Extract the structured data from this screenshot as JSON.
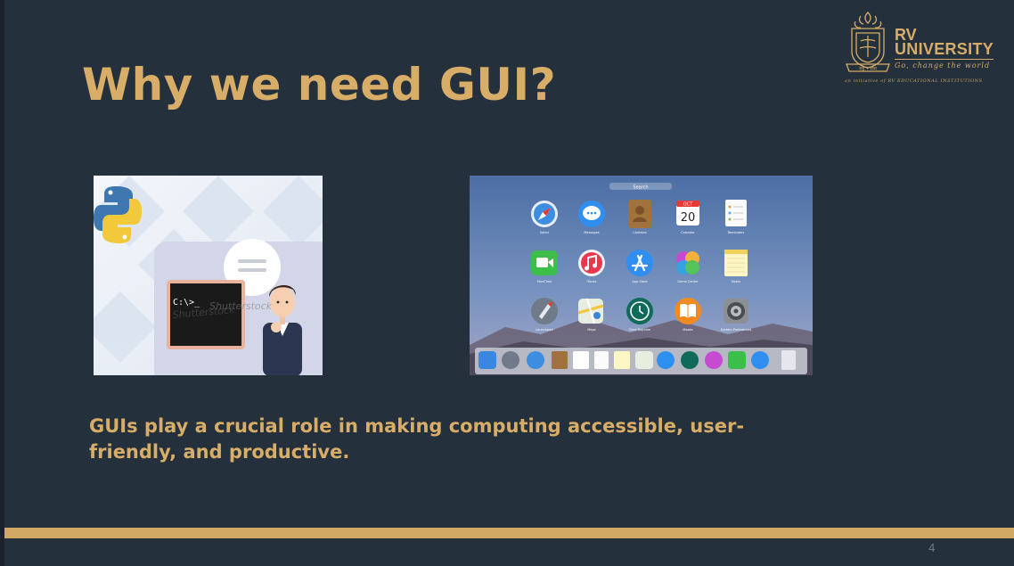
{
  "slide": {
    "title": "Why we need GUI?",
    "caption": "GUIs play a crucial role in making computing accessible, user-friendly, and productive.",
    "page_number": "4"
  },
  "logo": {
    "name_line1": "RV",
    "name_line2": "UNIVERSITY",
    "tagline": "Go, change the world",
    "subline": "an initiative of RV EDUCATIONAL INSTITUTIONS",
    "emblem_text": "राष्ट्र • सेवा"
  },
  "cli_image": {
    "prompt": "C:\\>_",
    "watermark": "Shutterstock"
  },
  "mac_image": {
    "search_placeholder": "Search",
    "calendar_month": "OCT",
    "calendar_day": "20",
    "apps": [
      "Safari",
      "Messages",
      "Contacts",
      "Calendar",
      "Reminders",
      "FaceTime",
      "iTunes",
      "App Store",
      "Game Center",
      "Notes",
      "Launchpad",
      "Maps",
      "Time Machine",
      "iBooks",
      "System Preferences"
    ]
  },
  "colors": {
    "background": "#24303c",
    "accent_gold": "#d7ad68"
  }
}
